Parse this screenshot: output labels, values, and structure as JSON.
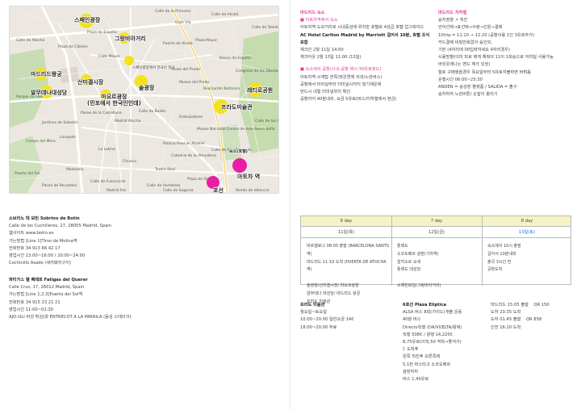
{
  "map": {
    "pins": [
      {
        "label": "스페인광장"
      },
      {
        "label": "그랑비아거리"
      },
      {
        "label": "마드리드왕궁"
      },
      {
        "label": "산미겔시장"
      },
      {
        "label": "알무데나대성당"
      },
      {
        "label": "마요르광장\n(민포에서 한국인인데)"
      },
      {
        "label": "솔광장"
      },
      {
        "label": "레티로공원"
      },
      {
        "label": "프라도미술관"
      },
      {
        "label": "아토차 역"
      },
      {
        "label": "숙소(호텔)"
      },
      {
        "label": "포선"
      }
    ],
    "streets": [
      "Calle de la Princesa",
      "Plaza de España",
      "Gran Vía",
      "Calle de Alcalá",
      "Plaza de Cibeles",
      "Puerta de Alcalá",
      "Calle Mayor",
      "Plaza Mayor",
      "Calle de Toledo",
      "Calle de Atocha",
      "Paseo del Prado",
      "Museo del Prado",
      "Real Jardín Botánico",
      "Museo Nacional Centro de Arte Reina Sofía",
      "Palacio Real de Madrid",
      "Catedral de la Almudena",
      "Teatro Real",
      "Jardines de Sabatini",
      "Campo del Moro",
      "Parque del Retiro",
      "Paseo de la Castellana",
      "Madrid Atocha",
      "Calle de Bailén",
      "Embajadores",
      "Lavapiés",
      "La Latina",
      "Chueca",
      "Malasaña",
      "Calle de Fuencarral",
      "Calle de Hortaleza",
      "Banco de España",
      "Congreso de los Diputados",
      "Calle de las Huertas",
      "Calle de San Bernardo",
      "Plaza de Oriente",
      "Puerta del Sol",
      "Paseo de Recoletos",
      "Madrid Río",
      "Calle de Segovia",
      "Ronda de Valencia"
    ],
    "sticker_text": "스페인광장에서 한국인 현금"
  },
  "venues": [
    {
      "title": "소브리노 데 보틴 Sobrino de Botín",
      "lines": [
        "Calle de los Cuchilleros, 17, 28005 Madrid, Spain",
        "웹사이트 www.botin.es",
        "가는방법 [Line 1]Tirso de Molina역",
        "전화번호 34 913 66 42 17",
        "영업시간 13:00~16:00 / 20:00~24:00",
        "Cochinillo Asado (새끼돼지구이)"
      ]
    },
    {
      "title": "파티가스 델 퀘레르 Fatigas del Querer",
      "lines": [
        "Calle Cruz, 17, 28012 Madrid, Spain",
        "가는방법 [Line 1,2,3]Puerta del Sol역",
        "전화번호 34 915 23 21 21",
        "영업시간 11:00~01:30",
        "AJO-OLI 버섯 튀김(와 ENTRECOT A LA PARRILA (등심 스테이크)"
      ]
    }
  ],
  "hotel": {
    "heading": "마드리드 숙소",
    "sub1": "■ 아토차역에서 숙소",
    "lines1": [
      "아토차역 도보거리로 시내중심에 위치한 호텔로 4성급 호텔 업그레이드",
      "AC Hotel Carlton Madrid by Marriott 걸어서 10분, 호텔 조식 포함",
      "체크인     2월 11일 14:00",
      "체크아웃    2월 13일 11:00 (13일)"
    ],
    "sub2": "■ 숙소에서 공항(시내-공항 택시 30유로정도)",
    "lines2": [
      "아토차역 시계탑 한쪽(맞은편에 외곽/노란버스)",
      "공항에서 터미널부터 터미널시까지 월기재운에",
      "번드시 내릴 터미널위치 확인",
      "공항까지 40분내외, 요금 5유로(버스/지하철에서 현금)"
    ]
  },
  "transport": {
    "heading": "마드리드 지하철",
    "lines": [
      "승차권을  ↗  직진",
      "언어선택→표선택→수량→인원→결제",
      "10trip = 11.10 → 12.20 (공항이용 1인 3유로추가)",
      "카드결제 비밀번호없이 승인되,",
      "기본 (4자리에 00입력하세요 4자리경우)",
      "시용방향(이미 피로 제게 해줘야 11이 1회승으로 어려웜 사용가능",
      "버킷웃에나는 멘드 체크 있엉)",
      "철로 구매했을경우 목요일부터 5유로지불하면 버튀옴",
      "운행시간 06:00~25:30",
      "ANDEN = 승강장 플랫폼 / SALIDA = 출구",
      "승차하자 노란버튼/ 손잡이 올리기"
    ]
  },
  "schedule": {
    "days": [
      "6 day",
      "7 day",
      "8 day"
    ],
    "dates": [
      "11일(목)",
      "12일(금)",
      "13일(토)"
    ],
    "col1": [
      "바르셀로나 08:00 출발 (BARCELONA SANTS 역)",
      "마드리드 11:10 도착    (PUERTA DE ATOCHA역)",
      "",
      "솔광장/산미겔시장/ 마요르광장",
      "알무데나 대성당/ 마드리드 왕궁",
      "프라도 미술관"
    ],
    "col2": [
      "톨레도",
      "소코도베르 광장(기차역)",
      "알카소르 요새",
      "톨레도 대성당",
      "",
      "소체빈보집(그랑비아거리)"
    ],
    "col3": [
      "숙소에서 10시 출발",
      "걸어서 10분내외",
      "출국 3시간 전",
      "공항도착"
    ]
  },
  "prado": {
    "title": "프라도 미술관",
    "lines": [
      "월요일~토요일",
      "10:00~20:00 일반요금 14€",
      "18:00~20:00 무료"
    ]
  },
  "toledo": {
    "title": "6호선 Plaza Eliptica",
    "lines": [
      "ALSA 버스 8회(가이드)개출 운동",
      "40분 버스",
      "Directo직행 (DA/VUELTA/왕복)",
      "직행 508€ / 왕행 14,22€€",
      "8,75유로(이직,50 적학→좋석가)",
      "》도착후",
      "왼쪽 직진후 오른쪽에",
      "5,1번 버스타고 소코도베르",
      "광장하차",
      "버스 1,40유로"
    ]
  },
  "flights": {
    "lines": [
      {
        "a": "마드리드 15:05 출발",
        "b": "QR 150"
      },
      {
        "a": "도하 23:35 도착",
        "b": ""
      },
      {
        "a": "도하 01:45 출발",
        "b": "QR 858"
      },
      {
        "a": "인천 16:10 도착",
        "b": ""
      }
    ]
  }
}
